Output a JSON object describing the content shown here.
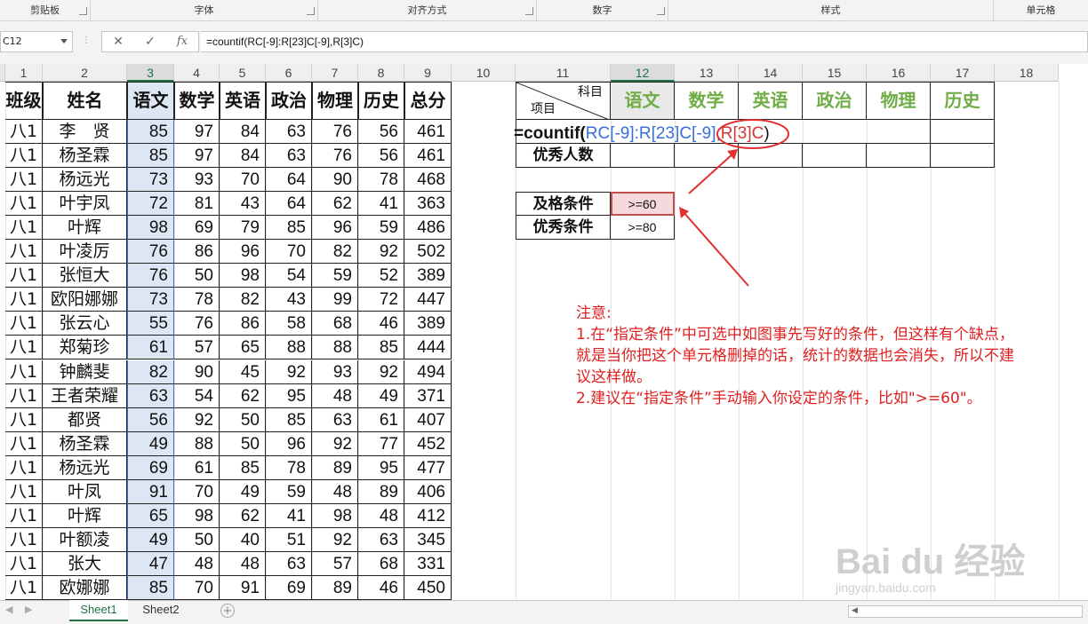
{
  "ribbon": {
    "groups": [
      "剪贴板",
      "字体",
      "对齐方式",
      "数字",
      "样式",
      "单元格"
    ]
  },
  "formula_bar": {
    "name_box": "C12",
    "cancel_icon": "✕",
    "enter_icon": "✓",
    "fx_label": "fx",
    "formula": "=countif(RC[-9]:R[23]C[-9],R[3]C)"
  },
  "columns": [
    "1",
    "2",
    "3",
    "4",
    "5",
    "6",
    "7",
    "8",
    "9",
    "10",
    "11",
    "12",
    "13",
    "14",
    "15",
    "16",
    "17",
    "18"
  ],
  "table": {
    "headers": [
      "班级",
      "姓名",
      "语文",
      "数学",
      "英语",
      "政治",
      "物理",
      "历史",
      "总分"
    ],
    "rows": [
      [
        "八1",
        "李　贤",
        "85",
        "97",
        "84",
        "63",
        "76",
        "56",
        "461"
      ],
      [
        "八1",
        "杨圣霖",
        "85",
        "97",
        "84",
        "63",
        "76",
        "56",
        "461"
      ],
      [
        "八1",
        "杨远光",
        "73",
        "93",
        "70",
        "64",
        "90",
        "78",
        "468"
      ],
      [
        "八1",
        "叶宇凤",
        "72",
        "81",
        "43",
        "64",
        "62",
        "41",
        "363"
      ],
      [
        "八1",
        "叶辉",
        "98",
        "69",
        "79",
        "85",
        "96",
        "59",
        "486"
      ],
      [
        "八1",
        "叶凌厉",
        "76",
        "86",
        "96",
        "70",
        "82",
        "92",
        "502"
      ],
      [
        "八1",
        "张恒大",
        "76",
        "50",
        "98",
        "54",
        "59",
        "52",
        "389"
      ],
      [
        "八1",
        "欧阳娜娜",
        "73",
        "78",
        "82",
        "43",
        "99",
        "72",
        "447"
      ],
      [
        "八1",
        "张云心",
        "55",
        "76",
        "86",
        "58",
        "68",
        "46",
        "389"
      ],
      [
        "八1",
        "郑菊珍",
        "61",
        "57",
        "65",
        "88",
        "88",
        "85",
        "444"
      ],
      [
        "八1",
        "钟麟斐",
        "82",
        "90",
        "45",
        "92",
        "93",
        "92",
        "494"
      ],
      [
        "八1",
        "王者荣耀",
        "63",
        "54",
        "62",
        "95",
        "48",
        "49",
        "371"
      ],
      [
        "八1",
        "都贤",
        "56",
        "92",
        "50",
        "85",
        "63",
        "61",
        "407"
      ],
      [
        "八1",
        "杨圣霖",
        "49",
        "88",
        "50",
        "96",
        "92",
        "77",
        "452"
      ],
      [
        "八1",
        "杨远光",
        "69",
        "61",
        "85",
        "78",
        "89",
        "95",
        "477"
      ],
      [
        "八1",
        "叶凤",
        "91",
        "70",
        "49",
        "59",
        "48",
        "89",
        "406"
      ],
      [
        "八1",
        "叶辉",
        "65",
        "98",
        "62",
        "41",
        "98",
        "48",
        "412"
      ],
      [
        "八1",
        "叶额凌",
        "49",
        "50",
        "40",
        "51",
        "92",
        "63",
        "345"
      ],
      [
        "八1",
        "张大",
        "47",
        "48",
        "48",
        "63",
        "57",
        "68",
        "331"
      ],
      [
        "八1",
        "欧娜娜",
        "85",
        "70",
        "91",
        "69",
        "89",
        "46",
        "450"
      ]
    ]
  },
  "summary": {
    "corner_top": "科目",
    "corner_bottom": "项目",
    "subjects": [
      "语文",
      "数学",
      "英语",
      "政治",
      "物理",
      "历史"
    ],
    "row_label": "优秀人数",
    "formula_parts": {
      "prefix": "=countif(",
      "range": "RC[-9]:R[23]C[-9]",
      "comma": ",",
      "criteria": "R[3]C",
      "suffix": ")"
    }
  },
  "conditions": [
    {
      "label": "及格条件",
      "value": ">=60"
    },
    {
      "label": "优秀条件",
      "value": ">=80"
    }
  ],
  "note": {
    "lines": [
      "注意:",
      "1.在“指定条件”中可选中如图事先写好的条件，但这样有个缺点，",
      "就是当你把这个单元格删掉的话，统计的数据也会消失，所以不建",
      "议这样做。",
      "2.建议在“指定条件”手动输入你设定的条件，比如\">=60\"。"
    ]
  },
  "sheet_tabs": [
    "Sheet1",
    "Sheet2"
  ],
  "watermark": {
    "brand": "Bai du 经验",
    "url": "jingyan.baidu.com"
  },
  "colors": {
    "accent": "#217346",
    "note_red": "#e02020",
    "subject_green": "#70ad47",
    "ref_blue": "#3a6fd8"
  }
}
